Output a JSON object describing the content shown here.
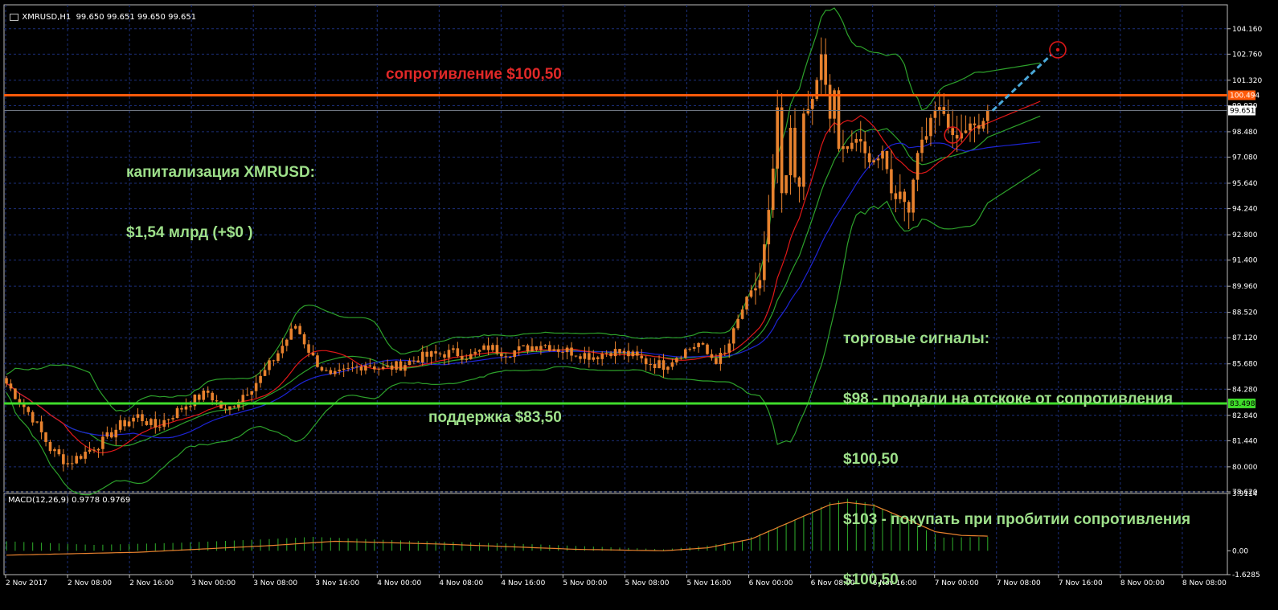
{
  "header": {
    "icon": "chart-window-icon",
    "symbol_line": "XMRUSD,H1  99.650 99.651 99.650 99.651",
    "macd_line": "MACD(12,26,9) 0.9778 0.9769"
  },
  "annotations": {
    "resistance": "сопротивление $100,50",
    "support": "поддержка $83,50",
    "cap_title": "капитализация XMRUSD:",
    "cap_value": "$1,54 млрд (+$0 )",
    "signals_title": "торговые сигналы:",
    "signal_1": "$98 - продали на отскоке от сопротивления",
    "signal_1_level": "$100,50",
    "signal_2": "$103 - покупать при пробитии сопротивления",
    "signal_2_level": "$100,50"
  },
  "colors": {
    "background": "#000000",
    "grid": "#1c2f7a",
    "candles": "#e8822e",
    "resistance": "#ff5a0a",
    "support": "#3fdc2b",
    "ma_fast": "#e01818",
    "ma_slow": "#1d24d4",
    "bollinger": "#2da12b",
    "macd_hist": "#2fae2b",
    "macd_signal": "#e8822e",
    "forecast": "#4aa8d8",
    "marker": "#d81818"
  },
  "chart_data": [
    {
      "type": "candlestick",
      "symbol": "XMRUSD",
      "timeframe": "H1",
      "ylim": [
        78.62,
        105.48
      ],
      "y_ticks": [
        "104.160",
        "102.760",
        "101.320",
        "99.920",
        "98.480",
        "97.080",
        "95.640",
        "94.240",
        "92.800",
        "91.400",
        "89.960",
        "88.520",
        "87.120",
        "85.680",
        "84.280",
        "82.840",
        "81.440",
        "80.000",
        "78.620"
      ],
      "x_ticks": [
        "2 Nov 2017",
        "2 Nov 08:00",
        "2 Nov 16:00",
        "3 Nov 00:00",
        "3 Nov 08:00",
        "3 Nov 16:00",
        "4 Nov 00:00",
        "4 Nov 08:00",
        "4 Nov 16:00",
        "5 Nov 00:00",
        "5 Nov 08:00",
        "5 Nov 16:00",
        "6 Nov 00:00",
        "6 Nov 08:00",
        "6 Nov 16:00",
        "7 Nov 00:00",
        "7 Nov 08:00",
        "7 Nov 16:00",
        "8 Nov 00:00",
        "8 Nov 08:00"
      ],
      "levels": [
        {
          "name": "resistance",
          "value": 100.494,
          "label": "100.494"
        },
        {
          "name": "support",
          "value": 83.498,
          "label": "83.498"
        },
        {
          "name": "current",
          "value": 99.651,
          "label": "99.651"
        }
      ],
      "close_key_points": [
        [
          0,
          84.6
        ],
        [
          6,
          82.7
        ],
        [
          10,
          81.0
        ],
        [
          14,
          80.2
        ],
        [
          18,
          80.8
        ],
        [
          22,
          81.4
        ],
        [
          26,
          82.3
        ],
        [
          30,
          82.8
        ],
        [
          34,
          82.2
        ],
        [
          38,
          82.9
        ],
        [
          42,
          83.6
        ],
        [
          46,
          84.1
        ],
        [
          50,
          83.0
        ],
        [
          54,
          84.0
        ],
        [
          58,
          84.9
        ],
        [
          62,
          86.3
        ],
        [
          66,
          87.8
        ],
        [
          70,
          86.0
        ],
        [
          74,
          84.9
        ],
        [
          78,
          85.3
        ],
        [
          82,
          85.7
        ],
        [
          86,
          85.4
        ],
        [
          90,
          85.6
        ],
        [
          94,
          86.0
        ],
        [
          98,
          86.2
        ],
        [
          102,
          86.3
        ],
        [
          106,
          86.1
        ],
        [
          110,
          86.6
        ],
        [
          114,
          86.3
        ],
        [
          118,
          86.5
        ],
        [
          122,
          86.8
        ],
        [
          126,
          86.5
        ],
        [
          130,
          86.3
        ],
        [
          134,
          86.1
        ],
        [
          138,
          86.4
        ],
        [
          142,
          86.2
        ],
        [
          146,
          85.8
        ],
        [
          150,
          85.6
        ],
        [
          154,
          86.3
        ],
        [
          158,
          86.8
        ],
        [
          160,
          86.2
        ],
        [
          162,
          85.9
        ],
        [
          164,
          86.2
        ],
        [
          166,
          87.4
        ],
        [
          168,
          88.7
        ],
        [
          170,
          89.5
        ],
        [
          172,
          90.3
        ],
        [
          174,
          94.0
        ],
        [
          175,
          96.2
        ],
        [
          176,
          99.8
        ],
        [
          177,
          94.8
        ],
        [
          178,
          96.0
        ],
        [
          179,
          98.5
        ],
        [
          180,
          96.0
        ],
        [
          181,
          95.7
        ],
        [
          182,
          99.2
        ],
        [
          184,
          100.2
        ],
        [
          186,
          102.6
        ],
        [
          188,
          99.2
        ],
        [
          189,
          100.8
        ],
        [
          190,
          97.3
        ],
        [
          192,
          97.8
        ],
        [
          194,
          98.1
        ],
        [
          196,
          97.2
        ],
        [
          198,
          96.8
        ],
        [
          200,
          97.6
        ],
        [
          202,
          95.2
        ],
        [
          204,
          94.9
        ],
        [
          206,
          94.3
        ],
        [
          208,
          97.5
        ],
        [
          210,
          98.4
        ],
        [
          212,
          99.8
        ],
        [
          214,
          99.4
        ],
        [
          216,
          98.1
        ],
        [
          218,
          98.5
        ],
        [
          220,
          98.7
        ],
        [
          222,
          98.9
        ],
        [
          224,
          99.65
        ]
      ]
    },
    {
      "type": "bar",
      "name": "MACD(12,26,9)",
      "values_shown": [
        0.9778,
        0.9769
      ],
      "ylim": [
        -1.6285,
        3.9114
      ],
      "y_ticks": [
        "3.9114",
        "0.00",
        "-1.6285"
      ],
      "histogram_key_points": [
        [
          0,
          0.65
        ],
        [
          20,
          0.4
        ],
        [
          40,
          0.55
        ],
        [
          60,
          0.8
        ],
        [
          70,
          0.95
        ],
        [
          90,
          0.7
        ],
        [
          120,
          0.45
        ],
        [
          150,
          0.1
        ],
        [
          160,
          0.35
        ],
        [
          168,
          0.7
        ],
        [
          175,
          1.5
        ],
        [
          182,
          2.4
        ],
        [
          188,
          3.3
        ],
        [
          192,
          3.55
        ],
        [
          198,
          3.2
        ],
        [
          204,
          2.3
        ],
        [
          210,
          1.4
        ],
        [
          214,
          0.9
        ],
        [
          224,
          0.95
        ]
      ],
      "signal_key_points": [
        [
          0,
          -0.3
        ],
        [
          30,
          -0.1
        ],
        [
          60,
          0.35
        ],
        [
          75,
          0.65
        ],
        [
          100,
          0.45
        ],
        [
          130,
          0.1
        ],
        [
          150,
          0.0
        ],
        [
          160,
          0.2
        ],
        [
          170,
          0.8
        ],
        [
          180,
          2.1
        ],
        [
          188,
          3.15
        ],
        [
          192,
          3.3
        ],
        [
          198,
          3.1
        ],
        [
          206,
          2.1
        ],
        [
          212,
          1.3
        ],
        [
          218,
          1.05
        ],
        [
          224,
          1.0
        ]
      ]
    }
  ]
}
